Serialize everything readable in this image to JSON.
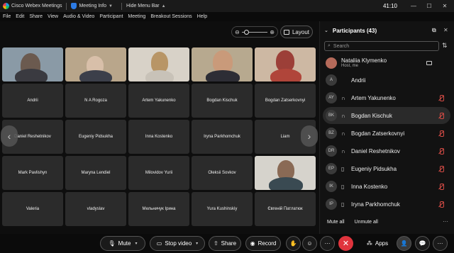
{
  "titlebar": {
    "app_name": "Cisco Webex Meetings",
    "meeting_info": "Meeting Info",
    "hide_menu": "Hide Menu Bar",
    "time": "41:10"
  },
  "menu": [
    "File",
    "Edit",
    "Share",
    "View",
    "Audio & Video",
    "Participant",
    "Meeting",
    "Breakout Sessions",
    "Help"
  ],
  "stage": {
    "layout_label": "Layout",
    "prev_icon": "chevron-left-icon",
    "next_icon": "chevron-right-icon"
  },
  "tiles": [
    "Andrii",
    "N A Rogoza",
    "Artem Yakunenko",
    "Bogdan Kischuk",
    "Bogdan Zatserkovnyi",
    "Daniel Reshetnikov",
    "Eugeniy Pidsukha",
    "Inna Kostenko",
    "Iryna Parkhomchuk",
    "Liam",
    "Mark Pavlishyn",
    "Maryna Lendiel",
    "Milovidov Yurii",
    "Oleksii Sovkov",
    "Valeria",
    "vladyslav",
    "Мельничук Ірина",
    "Yura Kushinskiy",
    "Євгеній Патлатюк"
  ],
  "panel": {
    "title": "Participants (43)",
    "search_placeholder": "Search",
    "host_name": "Nataliia Klymenko",
    "host_role": "Host, me",
    "participants": [
      {
        "initials": "A",
        "name": "Andrii"
      },
      {
        "initials": "AY",
        "name": "Artem Yakunenko"
      },
      {
        "initials": "BK",
        "name": "Bogdan Kischuk"
      },
      {
        "initials": "BZ",
        "name": "Bogdan Zatserkovnyi"
      },
      {
        "initials": "DR",
        "name": "Daniel Reshetnikov"
      },
      {
        "initials": "EP",
        "name": "Eugeniy Pidsukha"
      },
      {
        "initials": "IK",
        "name": "Inna Kostenko"
      },
      {
        "initials": "IP",
        "name": "Iryna Parkhomchuk"
      }
    ],
    "mute_all": "Mute all",
    "unmute_all": "Unmute all"
  },
  "toolbar": {
    "mute": "Mute",
    "stop_video": "Stop video",
    "share": "Share",
    "record": "Record",
    "apps": "Apps"
  },
  "colors": {
    "end_call": "#e0343d",
    "mute_red": "#d34b45",
    "background": "#0b0b0b"
  }
}
